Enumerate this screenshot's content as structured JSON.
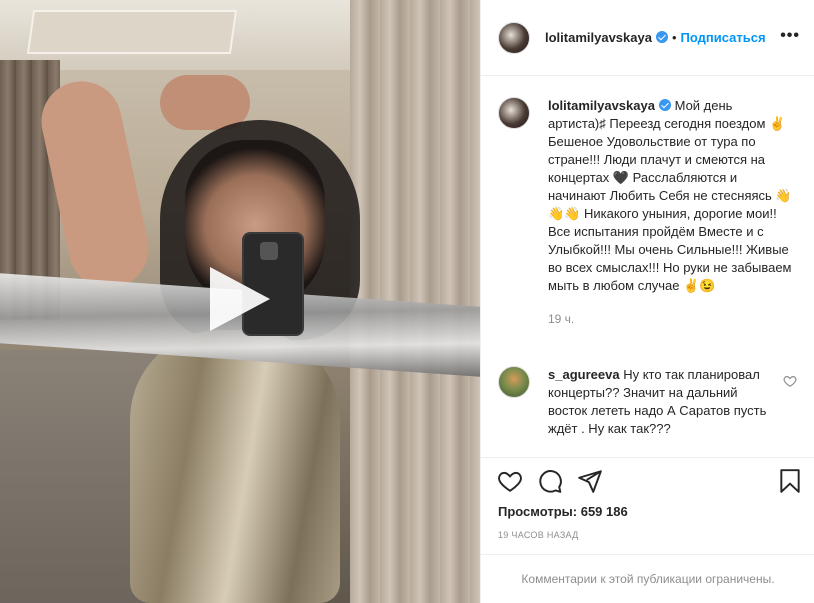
{
  "post": {
    "author": "lolitamilyavskaya",
    "separator": "•",
    "follow_label": "Подписаться",
    "more_label": "•••"
  },
  "caption": {
    "username": "lolitamilyavskaya",
    "text": "Мой день артиста)♯ Переезд сегодня поездом ✌️ Бешеное Удовольствие от тура по стране!!! Люди плачут и смеются на концертах 🖤 Расслабляются и начинают Любить Себя не стесняясь 👋👋👋 Никакого уныния, дорогие мои!! Все испытания пройдём Вместе и с Улыбкой!!! Мы очень Сильные!!! Живые во всех смыслах!!! Но руки не забываем мыть в любом случае ✌️😉",
    "time": "19 ч."
  },
  "comments": [
    {
      "username": "s_agureeva",
      "text": "Ну кто так планировал концерты?? Значит на дальний восток лететь надо А Саратов пусть ждёт . Ну как так???"
    }
  ],
  "actions": {
    "icons": [
      "heart-icon",
      "comment-icon",
      "share-icon",
      "bookmark-icon"
    ]
  },
  "stats": {
    "views_label": "Просмотры:",
    "views_value": "659 186",
    "posted_ago": "19 ЧАСОВ НАЗАД"
  },
  "footer": {
    "comments_disabled": "Комментарии к этой публикации ограничены."
  },
  "colors": {
    "accent": "#0095f6",
    "verified": "#3897f0",
    "muted": "#8e8e8e"
  }
}
